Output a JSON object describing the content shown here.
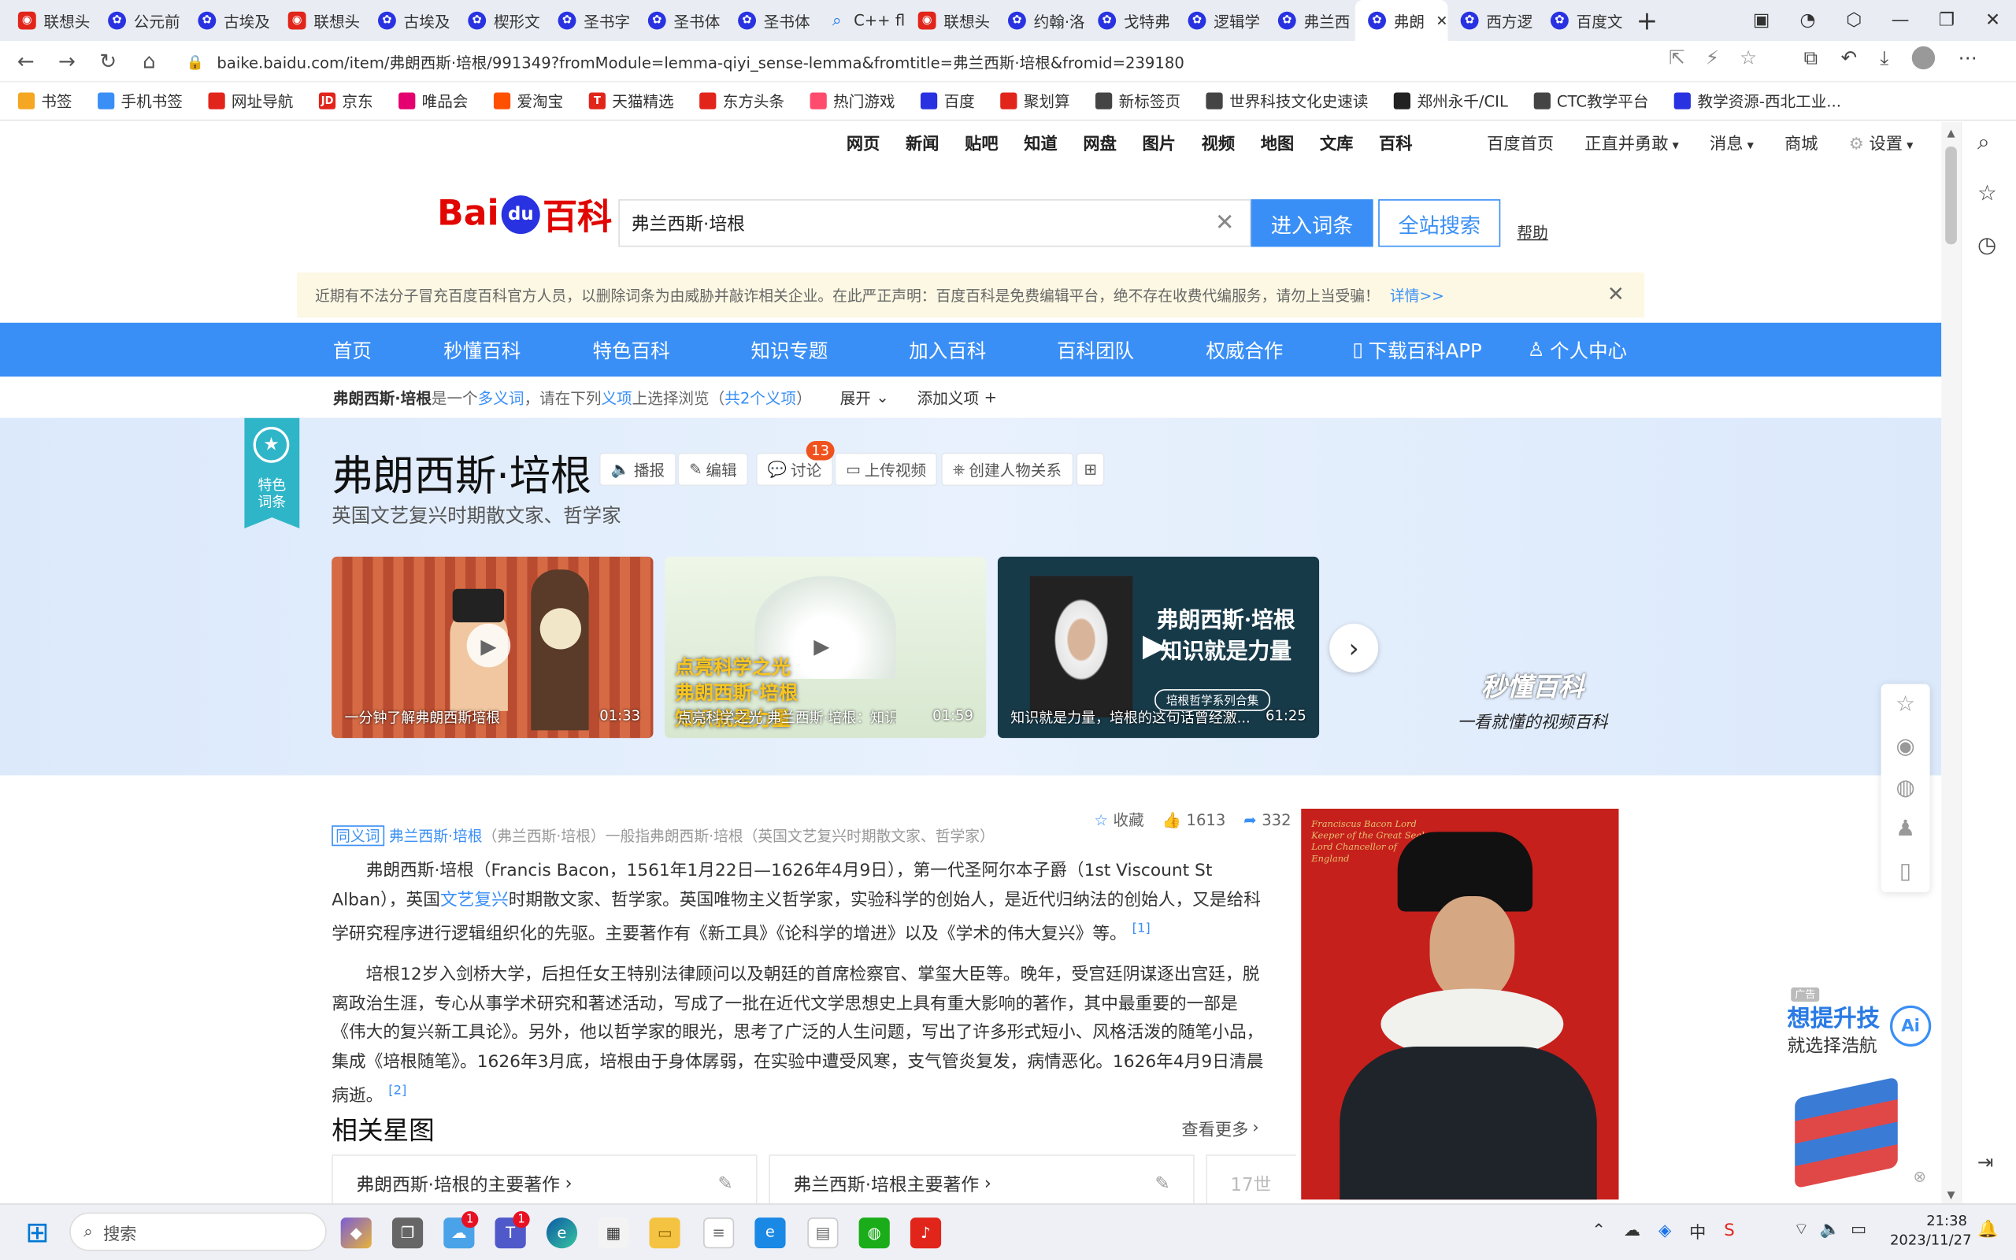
{
  "browser": {
    "tabs": [
      {
        "label": "联想头",
        "icon": "red-app-icon"
      },
      {
        "label": "公元前",
        "icon": "baidu-paw-icon"
      },
      {
        "label": "古埃及",
        "icon": "baidu-paw-icon"
      },
      {
        "label": "联想头",
        "icon": "red-app-icon"
      },
      {
        "label": "古埃及",
        "icon": "baidu-paw-icon"
      },
      {
        "label": "楔形文",
        "icon": "baidu-paw-icon"
      },
      {
        "label": "圣书字",
        "icon": "baidu-paw-icon"
      },
      {
        "label": "圣书体",
        "icon": "baidu-paw-icon"
      },
      {
        "label": "圣书体",
        "icon": "baidu-paw-icon"
      },
      {
        "label": "C++ flo",
        "icon": "search-icon"
      },
      {
        "label": "联想头",
        "icon": "red-app-icon"
      },
      {
        "label": "约翰·洛",
        "icon": "baidu-paw-icon"
      },
      {
        "label": "戈特弗",
        "icon": "baidu-paw-icon"
      },
      {
        "label": "逻辑学",
        "icon": "baidu-paw-icon"
      },
      {
        "label": "弗兰西",
        "icon": "baidu-paw-icon"
      },
      {
        "label": "弗朗",
        "icon": "baidu-paw-icon",
        "active": true
      },
      {
        "label": "西方逻",
        "icon": "baidu-paw-icon"
      },
      {
        "label": "百度文",
        "icon": "baidu-paw-icon"
      }
    ],
    "new_tab_symbol": "+",
    "url": "baike.baidu.com/item/弗朗西斯·培根/991349?fromModule=lemma-qiyi_sense-lemma&fromtitle=弗兰西斯·培根&fromid=239180",
    "bookmarks": [
      {
        "label": "书签",
        "color": "#f5a623"
      },
      {
        "label": "手机书签",
        "color": "#3a8ff6"
      },
      {
        "label": "网址导航",
        "color": "#e1251b"
      },
      {
        "label": "京东",
        "color": "#e1251b",
        "mark": "JD"
      },
      {
        "label": "唯品会",
        "color": "#e4006e"
      },
      {
        "label": "爱淘宝",
        "color": "#ff5000"
      },
      {
        "label": "天猫精选",
        "color": "#e1251b",
        "mark": "T"
      },
      {
        "label": "东方头条",
        "color": "#e1251b"
      },
      {
        "label": "热门游戏",
        "color": "#ff4b6e"
      },
      {
        "label": "百度",
        "color": "#2932e1"
      },
      {
        "label": "聚划算",
        "color": "#e1251b"
      },
      {
        "label": "新标签页",
        "color": "#444"
      },
      {
        "label": "世界科技文化史速读",
        "color": "#444"
      },
      {
        "label": "郑州永千/CIL",
        "color": "#222"
      },
      {
        "label": "CTC教学平台",
        "color": "#444"
      },
      {
        "label": "教学资源-西北工业...",
        "color": "#2932e1"
      }
    ]
  },
  "site": {
    "topnav_left": [
      "网页",
      "新闻",
      "贴吧",
      "知道",
      "网盘",
      "图片",
      "视频",
      "地图",
      "文库",
      "百科"
    ],
    "topnav_right": [
      "百度首页",
      "正直并勇敢",
      "消息",
      "商城",
      "设置"
    ],
    "logo_bai": "Bai",
    "logo_du": "du",
    "logo_baike": "百科",
    "search_value": "弗兰西斯·培根",
    "enter_button": "进入词条",
    "full_search_button": "全站搜索",
    "help": "帮助",
    "notice": "近期有不法分子冒充百度百科官方人员，以删除词条为由威胁并敲诈相关企业。在此严正声明：百度百科是免费编辑平台，绝不存在收费代编服务，请勿上当受骗！",
    "notice_link": "详情>>",
    "main_nav": [
      "首页",
      "秒懂百科",
      "特色百科",
      "知识专题",
      "加入百科",
      "百科团队",
      "权威合作"
    ],
    "download_app": "下载百科APP",
    "user_center": "个人中心"
  },
  "polysemy": {
    "term": "弗朗西斯·培根",
    "text1": "是一个",
    "link1": "多义词",
    "text2": "，请在下列",
    "link2": "义项",
    "text3": "上选择浏览（",
    "count": "共2个义项",
    "text4": "）",
    "expand": "展开",
    "add": "添加义项"
  },
  "lemma": {
    "ribbon": "特色\n词条",
    "title": "弗朗西斯·培根",
    "subtitle": "英国文艺复兴时期散文家、哲学家",
    "actions": [
      "播报",
      "编辑",
      "讨论",
      "上传视频",
      "创建人物关系"
    ],
    "discuss_count": "13"
  },
  "videos": [
    {
      "caption": "一分钟了解弗朗西斯培根",
      "duration": "01:33",
      "overlay": ""
    },
    {
      "caption": "点亮科学之光 弗兰西斯·培根：知识就...",
      "duration": "01:59",
      "overlay": "点亮科学之光\n弗朗西斯·培根\n知识就是力量"
    },
    {
      "caption": "知识就是力量，培根的这句话曾经激...",
      "duration": "61:25",
      "overlay": "弗朗西斯·培根\n知识就是力量",
      "series": "培根哲学系列合集"
    }
  ],
  "miaodong": {
    "logo": "秒懂百科",
    "slogan": "一看就懂的视频百科"
  },
  "stats": {
    "collect": "收藏",
    "likes": "1613",
    "shares": "332"
  },
  "synonym": {
    "tag": "同义词",
    "link": "弗兰西斯·培根",
    "text": "（弗兰西斯·培根）一般指弗朗西斯·培根（英国文艺复兴时期散文家、哲学家）"
  },
  "paragraphs": [
    {
      "pre": "弗朗西斯·培根（Francis Bacon，1561年1月22日—1626年4月9日），第一代圣阿尔本子爵（1st Viscount St Alban），英国",
      "link": "文艺复兴",
      "post": "时期散文家、哲学家。英国唯物主义哲学家，实验科学的创始人，是近代归纳法的创始人，又是给科学研究程序进行逻辑组织化的先驱。主要著作有《新工具》《论科学的增进》以及《学术的伟大复兴》等。",
      "ref": "[1]"
    },
    {
      "pre": "培根12岁入剑桥大学，后担任女王特别法律顾问以及朝廷的首席检察官、掌玺大臣等。晚年，受宫廷阴谋逐出宫廷，脱离政治生涯，专心从事学术研究和著述活动，写成了一批在近代文学思想史上具有重大影响的著作，其中最重要的一部是《伟大的复兴新工具论》。另外，他以哲学家的眼光，思考了广泛的人生问题，写出了许多形式短小、风格活泼的随笔小品，集成《培根随笔》。1626年3月底，培根由于身体孱弱，在实验中遭受风寒，支气管炎复发，病情恶化。1626年4月9日清晨病逝。",
      "link": "",
      "post": "",
      "ref": "[2]"
    }
  ],
  "starmap": {
    "title": "相关星图",
    "see_more": "查看更多",
    "cards": [
      "弗朗西斯·培根的主要著作",
      "弗兰西斯·培根主要著作",
      "17世"
    ]
  },
  "portrait": {
    "inscription": "Franciscus Bacon Lord\nKeeper of the Great Seal\nLord Chancellor of\nEngland"
  },
  "ad": {
    "tag": "广告",
    "line1": "想提升技",
    "line2": "就选择浩航"
  },
  "taskbar": {
    "search_placeholder": "搜索",
    "time": "21:38",
    "date": "2023/11/27",
    "ime": "中",
    "badges": {
      "cloud": "1",
      "teams": "1"
    }
  }
}
